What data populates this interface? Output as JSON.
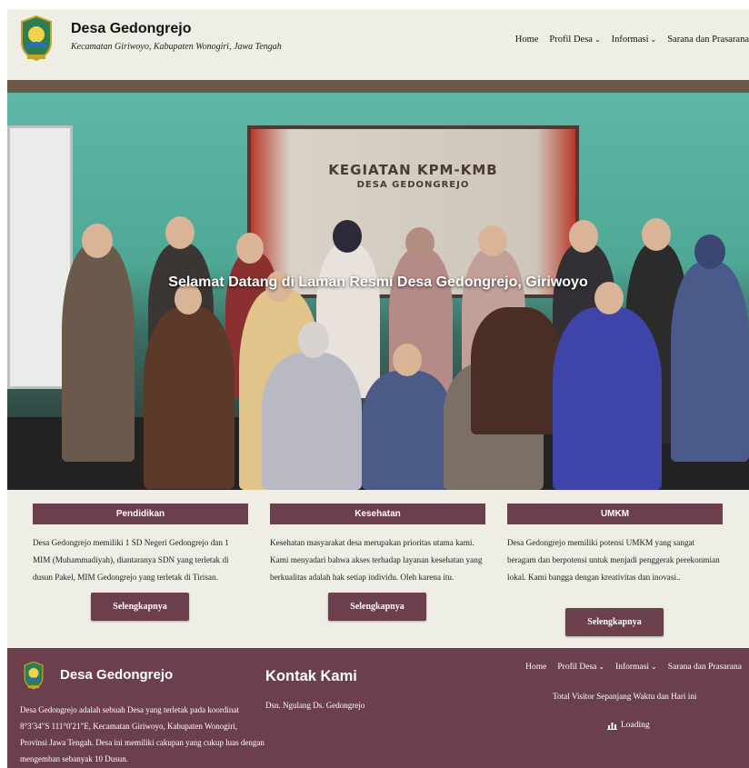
{
  "header": {
    "title": "Desa Gedongrejo",
    "subtitle": "Kecamatan Giriwoyo, Kabupaten Wonogiri, Jawa Tengah",
    "nav": [
      {
        "label": "Home",
        "dropdown": false
      },
      {
        "label": "Profil Desa",
        "dropdown": true
      },
      {
        "label": "Informasi",
        "dropdown": true
      },
      {
        "label": "Sarana dan Prasarana",
        "dropdown": false
      }
    ]
  },
  "hero": {
    "title": "Selamat Datang di Laman Resmi Desa Gedongrejo, Giriwoyo",
    "banner_title": "KEGIATAN KPM-KMB",
    "banner_subtitle": "DESA GEDONGREJO"
  },
  "features": [
    {
      "title": "Pendidikan",
      "text": "Desa Gedongrejo memiliki 1 SD Negeri Gedongrejo dan 1 MIM (Muhammadiyah), diantaranya SDN yang terletak di dusun Pakel, MIM Gedongrejo yang terletak di Tirisan.",
      "button": "Selengkapnya"
    },
    {
      "title": "Kesehatan",
      "text": "Kesehatan masyarakat desa merupakan prioritas utama kami. Kami menyadari bahwa akses terhadap layanan kesehatan yang berkualitas adalah hak setiap individu. Oleh karena itu.",
      "button": "Selengkapnya"
    },
    {
      "title": "UMKM",
      "text": "Desa Gedongrejo memiliki potensi UMKM yang sangat beragam dan berpotensi untuk menjadi penggerak perekonmian lokal. Kami bangga dengan kreativitas dan inovasi..",
      "button": "Selengkapnya"
    }
  ],
  "footer": {
    "title": "Desa Gedongrejo",
    "description": "Desa Gedongrejo adalah sebuah Desa yang terletak pada koordinat 8°3′34″S 111°0′21″E, Kecamatan Giriwoyo, Kabupaten Wonogiri, Provinsi Jawa Tengah. Desa ini memiliki cakupan yang cukup luas dengan mengemban sebanyak 10 Dusun.",
    "contact_title": "Kontak Kami",
    "contact_address": "Dsn. Ngulang Ds. Gedongrejo",
    "nav": [
      {
        "label": "Home",
        "dropdown": false
      },
      {
        "label": "Profil Desa",
        "dropdown": true
      },
      {
        "label": "Informasi",
        "dropdown": true
      },
      {
        "label": "Sarana dan Prasarana",
        "dropdown": false
      }
    ],
    "visitor_label": "Total Visitor Sepanjang Waktu dan Hari ini",
    "loading_label": "Loading"
  },
  "colors": {
    "primary": "#6b3f4b",
    "background": "#eeeee6"
  },
  "icons": {
    "logo": "village-emblem-icon",
    "dropdown": "chevron-down-icon",
    "chart": "bar-chart-icon"
  }
}
